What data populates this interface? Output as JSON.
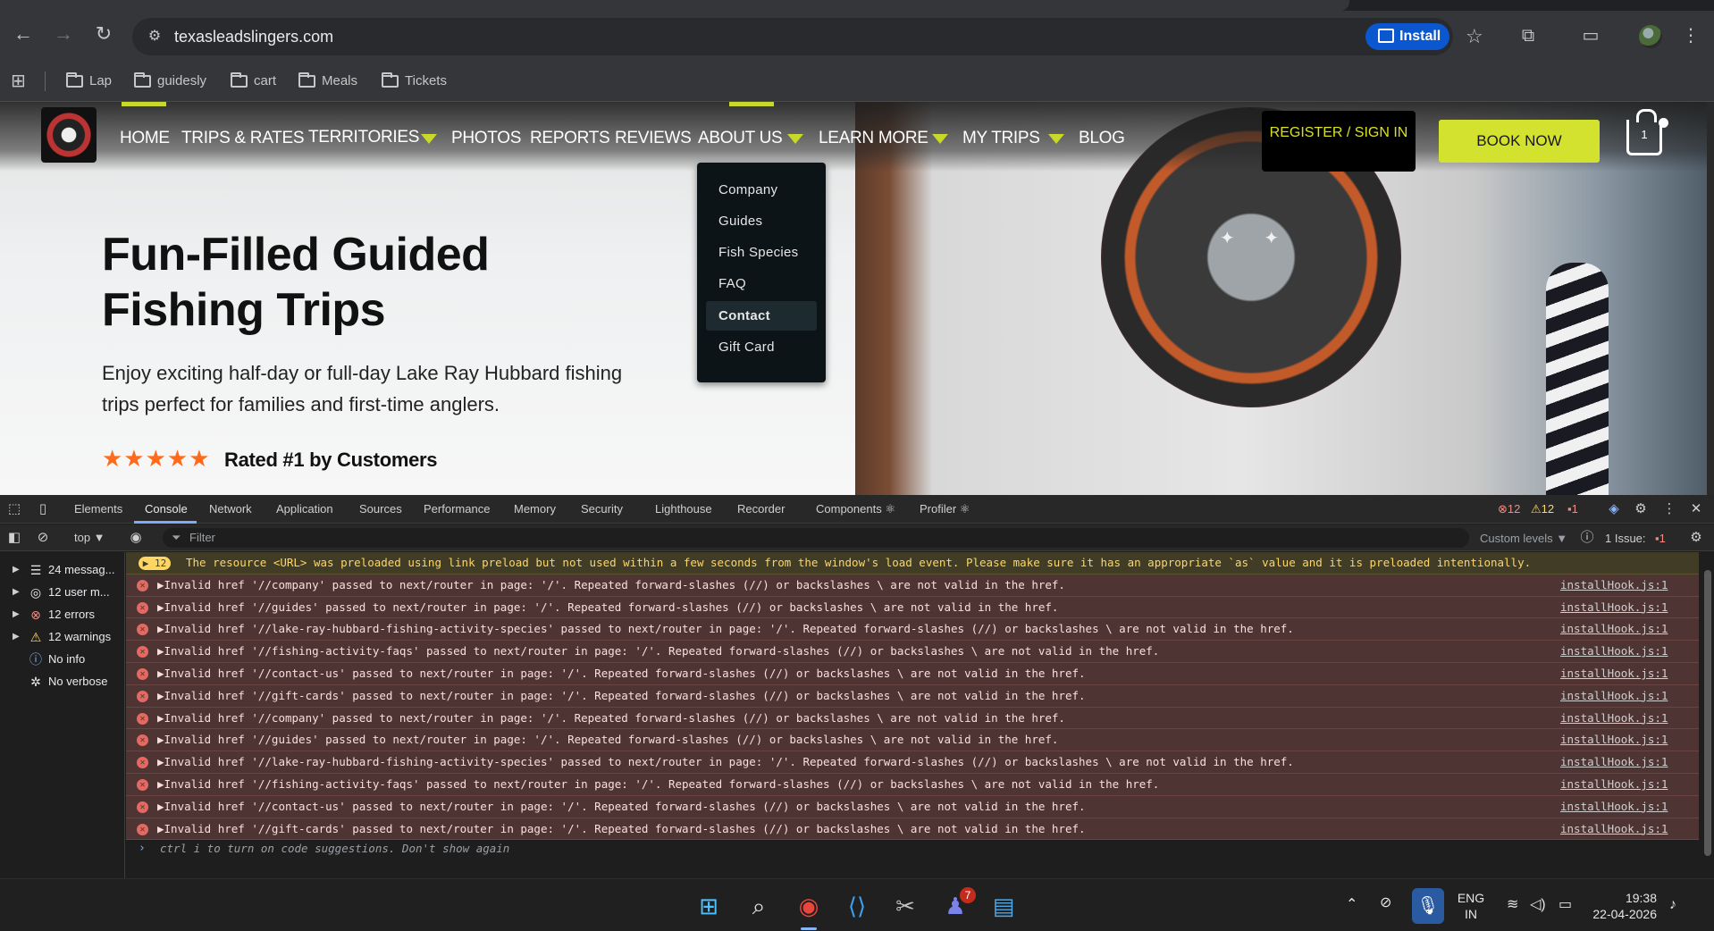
{
  "browser": {
    "url": "texasleadslingers.com",
    "install_label": "Install",
    "bookmarks": [
      "Lap",
      "guidesly",
      "cart",
      "Meals",
      "Tickets"
    ]
  },
  "site": {
    "nav": [
      "HOME",
      "TRIPS & RATES",
      "TERRITORIES",
      "PHOTOS",
      "REPORTS",
      "REVIEWS",
      "ABOUT US",
      "LEARN MORE",
      "MY TRIPS",
      "BLOG"
    ],
    "register_label": "REGISTER / SIGN IN",
    "book_label": "BOOK NOW",
    "cart_count": "1",
    "dropdown": [
      "Company",
      "Guides",
      "Fish Species",
      "FAQ",
      "Contact",
      "Gift Card"
    ],
    "hero_title_line1": "Fun-Filled Guided",
    "hero_title_line2": "Fishing Trips",
    "hero_subtitle_line1": "Enjoy exciting half-day or full-day Lake Ray Hubbard fishing",
    "hero_subtitle_line2": "trips perfect for families and first-time anglers.",
    "stars": "★★★★★",
    "rating_text": "Rated #1 by Customers",
    "colors": {
      "accent": "#c8d92a",
      "book": "#d3e22e",
      "stars": "#ff6b1a"
    }
  },
  "devtools": {
    "tabs": [
      "Elements",
      "Console",
      "Network",
      "Application",
      "Sources",
      "Performance",
      "Memory",
      "Security",
      "Lighthouse",
      "Recorder",
      "Components ⚛",
      "Profiler ⚛"
    ],
    "error_count": "12",
    "warning_count": "12",
    "issue_count": "1",
    "context": "top ▼",
    "filter_placeholder": "Filter",
    "levels": "Custom levels ▼",
    "issues_label": "1 Issue:",
    "issues_num": "1",
    "sidebar": [
      "24 messag...",
      "12 user m...",
      "12 errors",
      "12 warnings",
      "No info",
      "No verbose"
    ],
    "warning_badge": "▶ 12",
    "warning_message": "The resource <URL> was preloaded using link preload but not used within a few seconds from the window's load event. Please make sure it has an appropriate `as` value and it is preloaded intentionally.",
    "errors": [
      "▶Invalid href '//company' passed to next/router in page: '/'. Repeated forward-slashes (//) or backslashes \\ are not valid in the href.",
      "▶Invalid href '//guides' passed to next/router in page: '/'. Repeated forward-slashes (//) or backslashes \\ are not valid in the href.",
      "▶Invalid href '//lake-ray-hubbard-fishing-activity-species' passed to next/router in page: '/'. Repeated forward-slashes (//) or backslashes \\ are not valid in the href.",
      "▶Invalid href '//fishing-activity-faqs' passed to next/router in page: '/'. Repeated forward-slashes (//) or backslashes \\ are not valid in the href.",
      "▶Invalid href '//contact-us' passed to next/router in page: '/'. Repeated forward-slashes (//) or backslashes \\ are not valid in the href.",
      "▶Invalid href '//gift-cards' passed to next/router in page: '/'. Repeated forward-slashes (//) or backslashes \\ are not valid in the href.",
      "▶Invalid href '//company' passed to next/router in page: '/'. Repeated forward-slashes (//) or backslashes \\ are not valid in the href.",
      "▶Invalid href '//guides' passed to next/router in page: '/'. Repeated forward-slashes (//) or backslashes \\ are not valid in the href.",
      "▶Invalid href '//lake-ray-hubbard-fishing-activity-species' passed to next/router in page: '/'. Repeated forward-slashes (//) or backslashes \\ are not valid in the href.",
      "▶Invalid href '//fishing-activity-faqs' passed to next/router in page: '/'. Repeated forward-slashes (//) or backslashes \\ are not valid in the href.",
      "▶Invalid href '//contact-us' passed to next/router in page: '/'. Repeated forward-slashes (//) or backslashes \\ are not valid in the href.",
      "▶Invalid href '//gift-cards' passed to next/router in page: '/'. Repeated forward-slashes (//) or backslashes \\ are not valid in the href."
    ],
    "source_link": "installHook.js:1",
    "prompt_hint": "ctrl i to turn on code suggestions. Don't show again"
  },
  "taskbar": {
    "teams_badge": "7",
    "lang_line1": "ENG",
    "lang_line2": "IN",
    "time": "19:38",
    "date": "22-04-2026"
  }
}
